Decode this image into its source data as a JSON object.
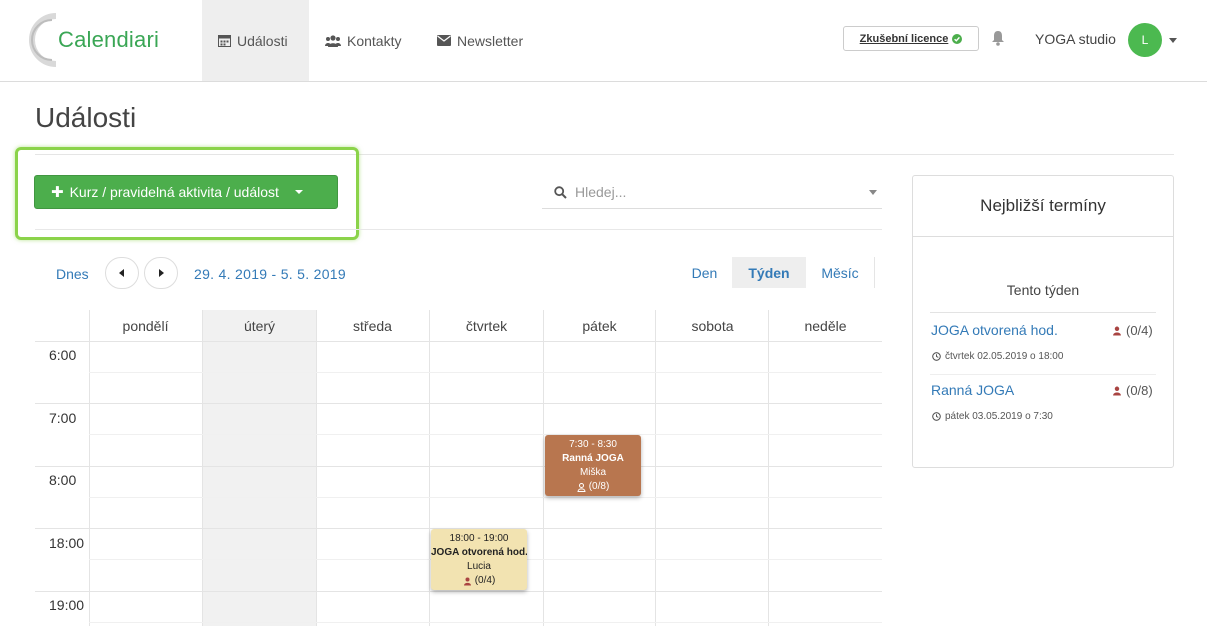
{
  "brand": {
    "name": "Calendiari",
    "color": "#3aa655"
  },
  "nav": [
    {
      "label": "Události",
      "icon": "calendar-icon",
      "active": true
    },
    {
      "label": "Kontakty",
      "icon": "users-icon",
      "active": false
    },
    {
      "label": "Newsletter",
      "icon": "envelope-icon",
      "active": false
    }
  ],
  "header": {
    "licence_label": "Zkušební licence",
    "studio_name": "YOGA studio",
    "avatar_initial": "L"
  },
  "page": {
    "title": "Události"
  },
  "toolbar": {
    "add_button_label": "Kurz / pravidelná aktivita / událost",
    "search_placeholder": "Hledej..."
  },
  "calendar": {
    "today_label": "Dnes",
    "range_label": "29. 4. 2019 - 5. 5. 2019",
    "views": [
      {
        "label": "Den",
        "active": false
      },
      {
        "label": "Týden",
        "active": true
      },
      {
        "label": "Měsíc",
        "active": false
      }
    ],
    "days": [
      "pondělí",
      "úterý",
      "středa",
      "čtvrtek",
      "pátek",
      "sobota",
      "neděle"
    ],
    "times": [
      "6:00",
      "7:00",
      "8:00",
      "18:00",
      "19:00"
    ],
    "events": [
      {
        "time": "7:30 - 8:30",
        "name": "Ranná JOGA",
        "instructor": "Miška",
        "capacity": "(0/8)",
        "color": "#b8764f"
      },
      {
        "time": "18:00 - 19:00",
        "name": "JOGA otvorená hod.",
        "instructor": "Lucia",
        "capacity": "(0/4)",
        "color": "#f2e3b1"
      }
    ]
  },
  "sidebar": {
    "title": "Nejbližší termíny",
    "week_label": "Tento týden",
    "terms": [
      {
        "name": "JOGA otvorená hod.",
        "capacity": "(0/4)",
        "date": "čtvrtek 02.05.2019 o 18:00"
      },
      {
        "name": "Ranná JOGA",
        "capacity": "(0/8)",
        "date": "pátek 03.05.2019 o 7:30"
      }
    ]
  }
}
